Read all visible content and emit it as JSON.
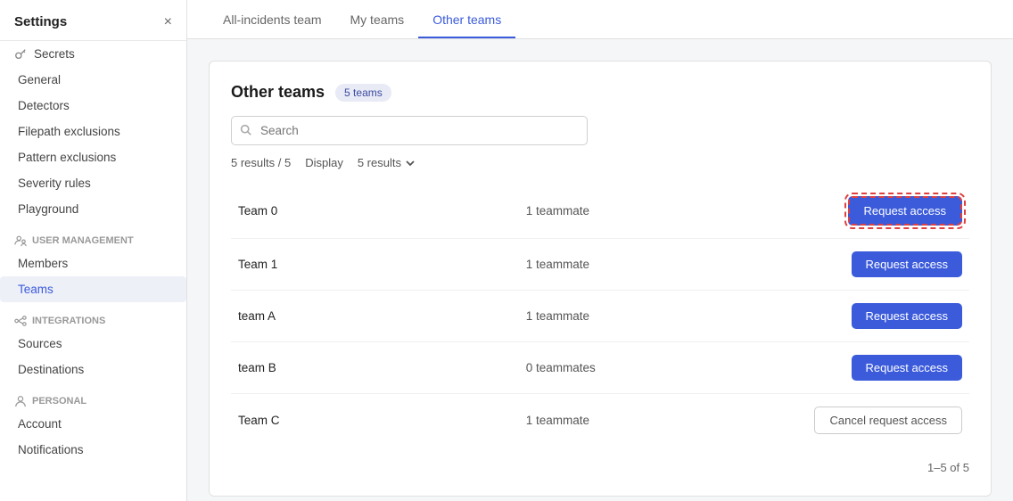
{
  "sidebar": {
    "title": "Settings",
    "close_label": "×",
    "sections": [
      {
        "id": "general",
        "items": [
          {
            "id": "secrets",
            "label": "Secrets",
            "icon": "key-icon",
            "active": false
          },
          {
            "id": "general",
            "label": "General",
            "icon": null,
            "active": false
          },
          {
            "id": "detectors",
            "label": "Detectors",
            "icon": null,
            "active": false
          },
          {
            "id": "filepath-exclusions",
            "label": "Filepath exclusions",
            "icon": null,
            "active": false
          },
          {
            "id": "pattern-exclusions",
            "label": "Pattern exclusions",
            "icon": null,
            "active": false
          },
          {
            "id": "severity-rules",
            "label": "Severity rules",
            "icon": null,
            "active": false
          },
          {
            "id": "playground",
            "label": "Playground",
            "icon": null,
            "active": false
          }
        ]
      },
      {
        "id": "user-management",
        "label": "User management",
        "icon": "users-icon",
        "items": [
          {
            "id": "members",
            "label": "Members",
            "active": false
          },
          {
            "id": "teams",
            "label": "Teams",
            "active": true
          }
        ]
      },
      {
        "id": "integrations",
        "label": "Integrations",
        "icon": "integrations-icon",
        "items": [
          {
            "id": "sources",
            "label": "Sources",
            "active": false
          },
          {
            "id": "destinations",
            "label": "Destinations",
            "active": false
          }
        ]
      },
      {
        "id": "personal",
        "label": "Personal",
        "icon": "person-icon",
        "items": [
          {
            "id": "account",
            "label": "Account",
            "active": false
          },
          {
            "id": "notifications",
            "label": "Notifications",
            "active": false
          }
        ]
      }
    ]
  },
  "tabs": [
    {
      "id": "all-incidents",
      "label": "All-incidents team",
      "active": false
    },
    {
      "id": "my-teams",
      "label": "My teams",
      "active": false
    },
    {
      "id": "other-teams",
      "label": "Other teams",
      "active": true
    }
  ],
  "content": {
    "title": "Other teams",
    "badge": "5 teams",
    "search_placeholder": "Search",
    "results_text": "5 results / 5",
    "display_label": "Display",
    "display_value": "5 results",
    "teams": [
      {
        "id": "team0",
        "name": "Team 0",
        "members": "1 teammate",
        "action": "request",
        "highlighted": true
      },
      {
        "id": "team1",
        "name": "Team 1",
        "members": "1 teammate",
        "action": "request",
        "highlighted": false
      },
      {
        "id": "teamA",
        "name": "team A",
        "members": "1 teammate",
        "action": "request",
        "highlighted": false
      },
      {
        "id": "teamB",
        "name": "team B",
        "members": "0 teammates",
        "action": "request",
        "highlighted": false
      },
      {
        "id": "teamC",
        "name": "Team C",
        "members": "1 teammate",
        "action": "cancel",
        "highlighted": false
      }
    ],
    "request_btn_label": "Request access",
    "cancel_btn_label": "Cancel request access",
    "pagination": "1–5 of 5"
  }
}
